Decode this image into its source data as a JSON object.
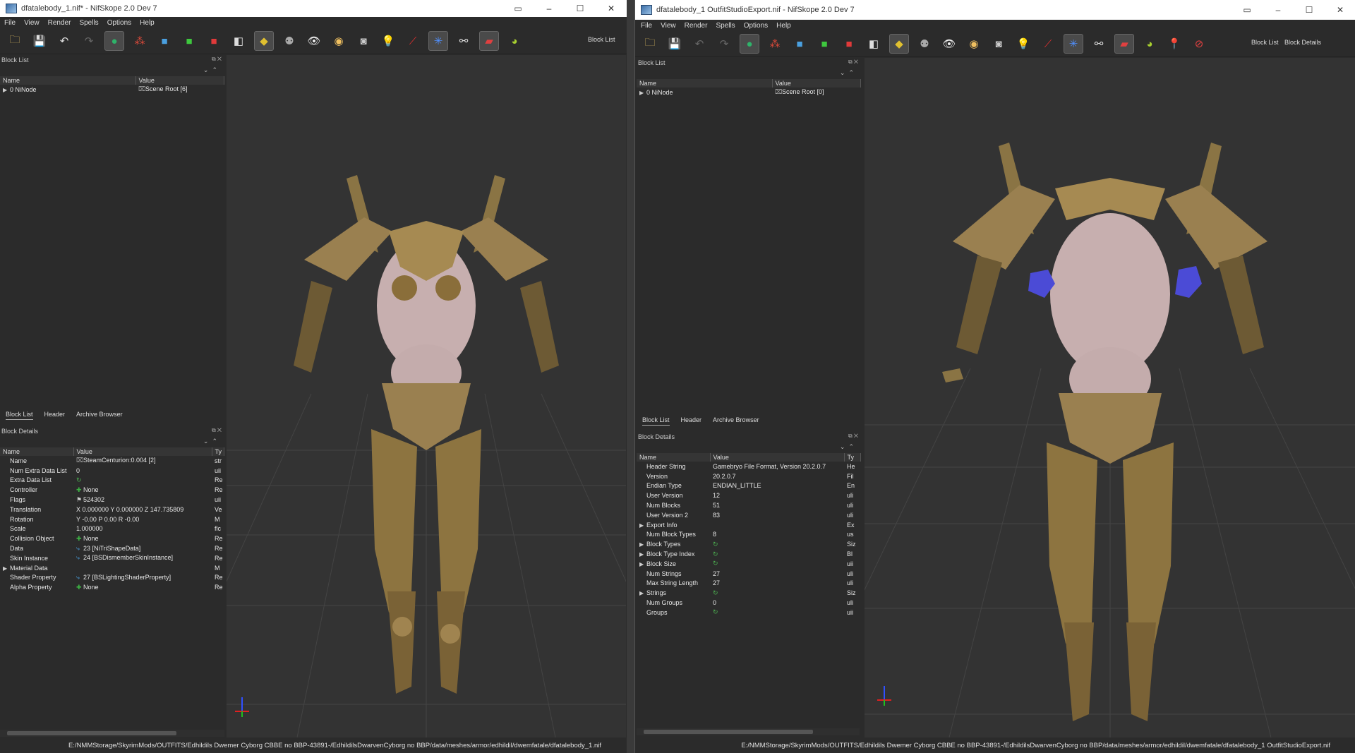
{
  "left": {
    "title": "dfatalebody_1.nif* - NifSkope 2.0 Dev 7",
    "window_controls": [
      "–",
      "☐",
      "✕"
    ],
    "menu": [
      "File",
      "View",
      "Render",
      "Spells",
      "Options",
      "Help"
    ],
    "toolbar_label": "Block List",
    "block_list": {
      "title": "Block List",
      "columns": [
        "Name",
        "Value"
      ],
      "rows": [
        {
          "name": "0 NiNode",
          "value": "Scene Root [6]"
        }
      ]
    },
    "tabs": [
      "Block List",
      "Header",
      "Archive Browser"
    ],
    "block_details": {
      "title": "Block Details",
      "columns": [
        "Name",
        "Value",
        "Ty"
      ],
      "rows": [
        {
          "name": "Name",
          "value": "SteamCenturion:0.004 [2]",
          "type": "str"
        },
        {
          "name": "Num Extra Data List",
          "value": "0",
          "type": "uii"
        },
        {
          "name": "Extra Data List",
          "value": "",
          "type": "Re"
        },
        {
          "name": "Controller",
          "value": "None",
          "type": "Re"
        },
        {
          "name": "Flags",
          "value": "524302",
          "type": "uii"
        },
        {
          "name": "Translation",
          "value": "X 0.000000 Y 0.000000 Z 147.735809",
          "type": "Ve"
        },
        {
          "name": "Rotation",
          "value": "Y -0.00 P 0.00 R -0.00",
          "type": "M"
        },
        {
          "name": "Scale",
          "value": "1.000000",
          "type": "flc"
        },
        {
          "name": "Collision Object",
          "value": "None",
          "type": "Re"
        },
        {
          "name": "Data",
          "value": "23 [NiTriShapeData]",
          "type": "Re"
        },
        {
          "name": "Skin Instance",
          "value": "24 [BSDismemberSkinInstance]",
          "type": "Re"
        },
        {
          "name": "Material Data",
          "value": "",
          "type": "M"
        },
        {
          "name": "Shader Property",
          "value": "27 [BSLightingShaderProperty]",
          "type": "Re"
        },
        {
          "name": "Alpha Property",
          "value": "None",
          "type": "Re"
        }
      ]
    },
    "status_path": "E:/NMMStorage/SkyrimMods/OUTFITS/Edhildils Dwemer Cyborg CBBE no BBP-43891-/EdhildilsDwarvenCyborg no BBP/data/meshes/armor/edhildil/dwemfatale/dfatalebody_1.nif"
  },
  "right": {
    "title": "dfatalebody_1 OutfitStudioExport.nif - NifSkope 2.0 Dev 7",
    "window_controls": [
      "–",
      "☐",
      "✕"
    ],
    "menu": [
      "File",
      "View",
      "Render",
      "Spells",
      "Options",
      "Help"
    ],
    "toolbar_labels": [
      "Block List",
      "Block Details"
    ],
    "block_list": {
      "title": "Block List",
      "columns": [
        "Name",
        "Value"
      ],
      "rows": [
        {
          "name": "0 NiNode",
          "value": "Scene Root [0]"
        }
      ]
    },
    "tabs": [
      "Block List",
      "Header",
      "Archive Browser"
    ],
    "block_details": {
      "title": "Block Details",
      "columns": [
        "Name",
        "Value",
        "Ty"
      ],
      "rows": [
        {
          "name": "Header String",
          "value": "Gamebryo File Format, Version 20.2.0.7",
          "type": "He"
        },
        {
          "name": "Version",
          "value": "20.2.0.7",
          "type": "Fil"
        },
        {
          "name": "Endian Type",
          "value": "ENDIAN_LITTLE",
          "type": "En"
        },
        {
          "name": "User Version",
          "value": "12",
          "type": "uli"
        },
        {
          "name": "Num Blocks",
          "value": "51",
          "type": "uli"
        },
        {
          "name": "User Version 2",
          "value": "83",
          "type": "uli"
        },
        {
          "name": "Export Info",
          "value": "",
          "type": "Ex"
        },
        {
          "name": "Num Block Types",
          "value": "8",
          "type": "us"
        },
        {
          "name": "Block Types",
          "value": "",
          "type": "Siz"
        },
        {
          "name": "Block Type Index",
          "value": "",
          "type": "Bl"
        },
        {
          "name": "Block Size",
          "value": "",
          "type": "uii"
        },
        {
          "name": "Num Strings",
          "value": "27",
          "type": "uli"
        },
        {
          "name": "Max String Length",
          "value": "27",
          "type": "uli"
        },
        {
          "name": "Strings",
          "value": "",
          "type": "Siz"
        },
        {
          "name": "Num Groups",
          "value": "0",
          "type": "uli"
        },
        {
          "name": "Groups",
          "value": "",
          "type": "uii"
        }
      ]
    },
    "status_path": "E:/NMMStorage/SkyrimMods/OUTFITS/Edhildils Dwemer Cyborg CBBE no BBP-43891-/EdhildilsDwarvenCyborg no BBP/data/meshes/armor/edhildil/dwemfatale/dfatalebody_1 OutfitStudioExport.nif"
  },
  "colors": {
    "bg": "#2b2b2b",
    "viewport": "#333333",
    "grid": "#4a4a4a",
    "gold": "#b89a5a",
    "skin": "#c9b0b0",
    "paint": "#4b4bd6"
  }
}
